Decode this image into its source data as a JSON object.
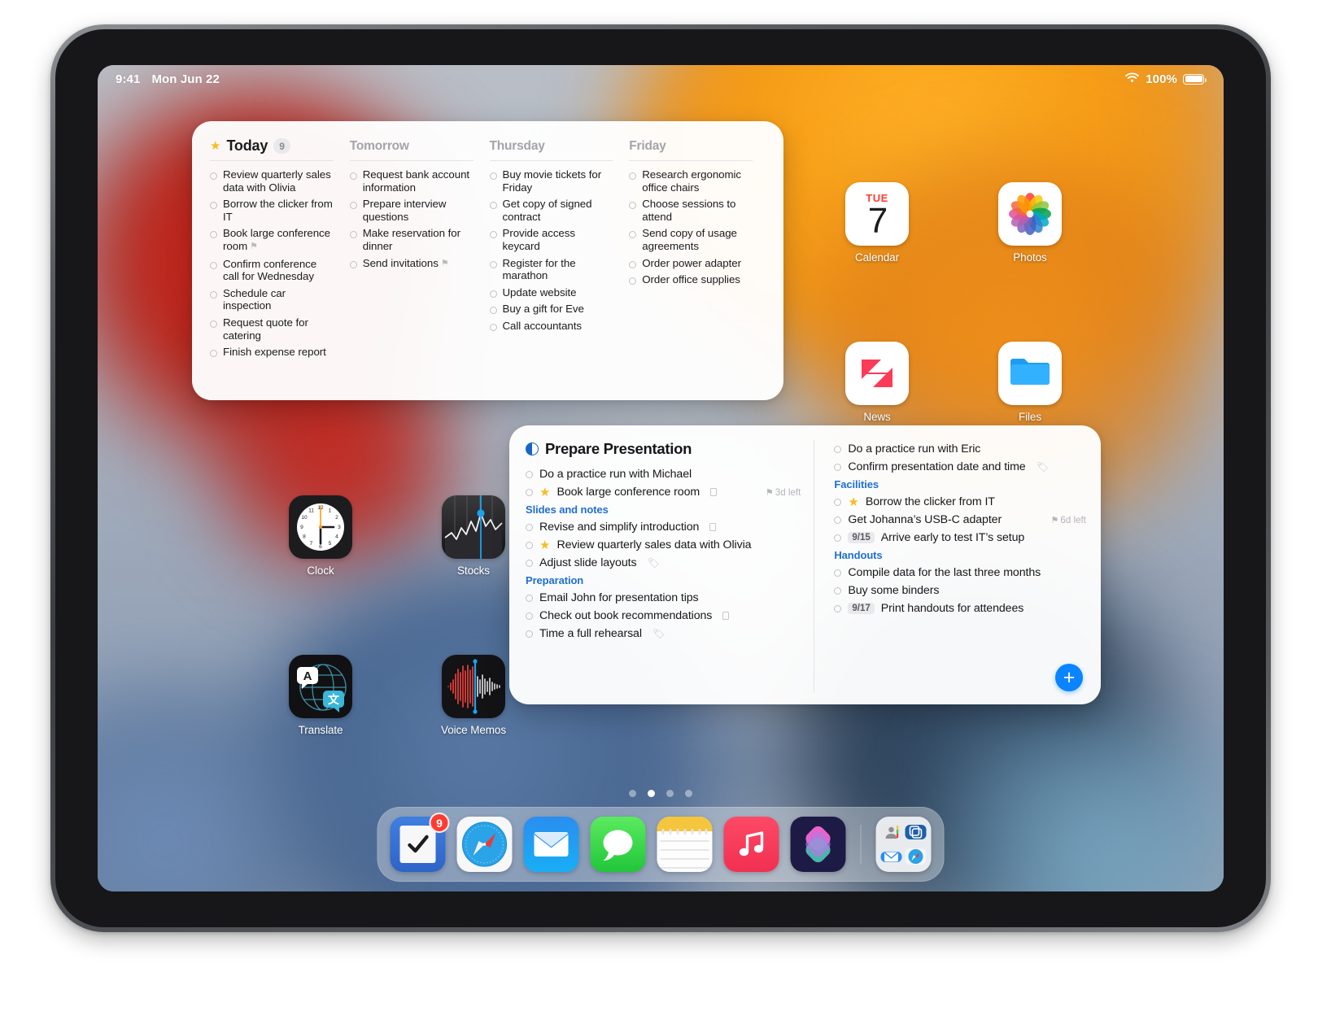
{
  "status_bar": {
    "time": "9:41",
    "date": "Mon Jun 22",
    "battery_text": "100%",
    "wifi_icon": "wifi-icon",
    "battery_icon": "battery-full-icon"
  },
  "scheduled_widget": {
    "columns": [
      {
        "title": "Today",
        "starred": true,
        "count": "9",
        "tasks": [
          {
            "text": "Review quarterly sales data with Olivia",
            "flag": false
          },
          {
            "text": "Borrow the clicker from IT",
            "flag": false
          },
          {
            "text": "Book large conference room",
            "flag": true
          },
          {
            "text": "Confirm conference call for Wednesday",
            "flag": false
          },
          {
            "text": "Schedule car inspection",
            "flag": false
          },
          {
            "text": "Request quote for catering",
            "flag": false
          },
          {
            "text": "Finish expense report",
            "flag": false
          }
        ]
      },
      {
        "title": "Tomorrow",
        "starred": false,
        "count": "",
        "tasks": [
          {
            "text": "Request bank account information",
            "flag": false
          },
          {
            "text": "Prepare interview questions",
            "flag": false
          },
          {
            "text": "Make reservation for dinner",
            "flag": false
          },
          {
            "text": "Send invitations",
            "flag": true
          }
        ]
      },
      {
        "title": "Thursday",
        "starred": false,
        "count": "",
        "tasks": [
          {
            "text": "Buy movie tickets for Friday",
            "flag": false
          },
          {
            "text": "Get copy of signed contract",
            "flag": false
          },
          {
            "text": "Provide access keycard",
            "flag": false
          },
          {
            "text": "Register for the marathon",
            "flag": false
          },
          {
            "text": "Update website",
            "flag": false
          },
          {
            "text": "Buy a gift for Eve",
            "flag": false
          },
          {
            "text": "Call accountants",
            "flag": false
          }
        ]
      },
      {
        "title": "Friday",
        "starred": false,
        "count": "",
        "tasks": [
          {
            "text": "Research ergonomic office chairs",
            "flag": false
          },
          {
            "text": "Choose sessions to attend",
            "flag": false
          },
          {
            "text": "Send copy of usage agreements",
            "flag": false
          },
          {
            "text": "Order power adapter",
            "flag": false
          },
          {
            "text": "Order office supplies",
            "flag": false
          }
        ]
      }
    ]
  },
  "list_widget": {
    "title": "Prepare Presentation",
    "add_button_label": "+",
    "left_rows": [
      {
        "kind": "task",
        "text": "Do a practice run with Michael"
      },
      {
        "kind": "task",
        "text": "Book large conference room",
        "starred": true,
        "note": true,
        "due": "3d left"
      },
      {
        "kind": "section",
        "text": "Slides and notes"
      },
      {
        "kind": "task",
        "text": "Revise and simplify introduction",
        "note": true
      },
      {
        "kind": "task",
        "text": "Review quarterly sales data with Olivia",
        "starred": true
      },
      {
        "kind": "task",
        "text": "Adjust slide layouts",
        "tag": true
      },
      {
        "kind": "section",
        "text": "Preparation"
      },
      {
        "kind": "task",
        "text": "Email John for presentation tips"
      },
      {
        "kind": "task",
        "text": "Check out book recommendations",
        "note": true
      },
      {
        "kind": "task",
        "text": "Time a full rehearsal",
        "tag": true
      }
    ],
    "right_rows": [
      {
        "kind": "task",
        "text": "Do a practice run with Eric"
      },
      {
        "kind": "task",
        "text": "Confirm presentation date and time",
        "tag": true
      },
      {
        "kind": "section",
        "text": "Facilities"
      },
      {
        "kind": "task",
        "text": "Borrow the clicker from IT",
        "starred": true
      },
      {
        "kind": "task",
        "text": "Get Johanna’s USB-C adapter",
        "due": "6d left"
      },
      {
        "kind": "task",
        "text": "Arrive early to test IT’s setup",
        "date": "9/15"
      },
      {
        "kind": "section",
        "text": "Handouts"
      },
      {
        "kind": "task",
        "text": "Compile data for the last three months"
      },
      {
        "kind": "task",
        "text": "Buy some binders"
      },
      {
        "kind": "task",
        "text": "Print handouts for attendees",
        "date": "9/17"
      }
    ]
  },
  "home_apps": [
    {
      "name": "Calendar",
      "icon": "calendar-icon",
      "day_of_week": "TUE",
      "day_number": "7"
    },
    {
      "name": "Photos",
      "icon": "photos-icon"
    },
    {
      "name": "News",
      "icon": "news-icon"
    },
    {
      "name": "Files",
      "icon": "files-icon"
    },
    {
      "name": "Clock",
      "icon": "clock-icon"
    },
    {
      "name": "Stocks",
      "icon": "stocks-icon"
    },
    {
      "name": "Translate",
      "icon": "translate-icon"
    },
    {
      "name": "Voice Memos",
      "icon": "voice-memos-icon"
    }
  ],
  "page_dots": {
    "count": 4,
    "active_index": 1
  },
  "dock": {
    "items": [
      {
        "name": "Reminders",
        "icon": "reminders-icon",
        "badge": "9"
      },
      {
        "name": "Safari",
        "icon": "safari-compass-icon"
      },
      {
        "name": "Mail",
        "icon": "mail-envelope-icon"
      },
      {
        "name": "Messages",
        "icon": "messages-bubble-icon"
      },
      {
        "name": "Notes",
        "icon": "notes-icon"
      },
      {
        "name": "Music",
        "icon": "music-note-icon"
      },
      {
        "name": "Shortcuts",
        "icon": "shortcuts-icon"
      },
      {
        "name": "Recents Folder",
        "icon": "recent-apps-folder-icon"
      }
    ]
  },
  "colors": {
    "accent_blue": "#0a84ff",
    "section_blue": "#1f6fd0",
    "star_yellow": "#f5bd21",
    "badge_red": "#ff3b30",
    "calendar_red": "#ff3b30"
  }
}
